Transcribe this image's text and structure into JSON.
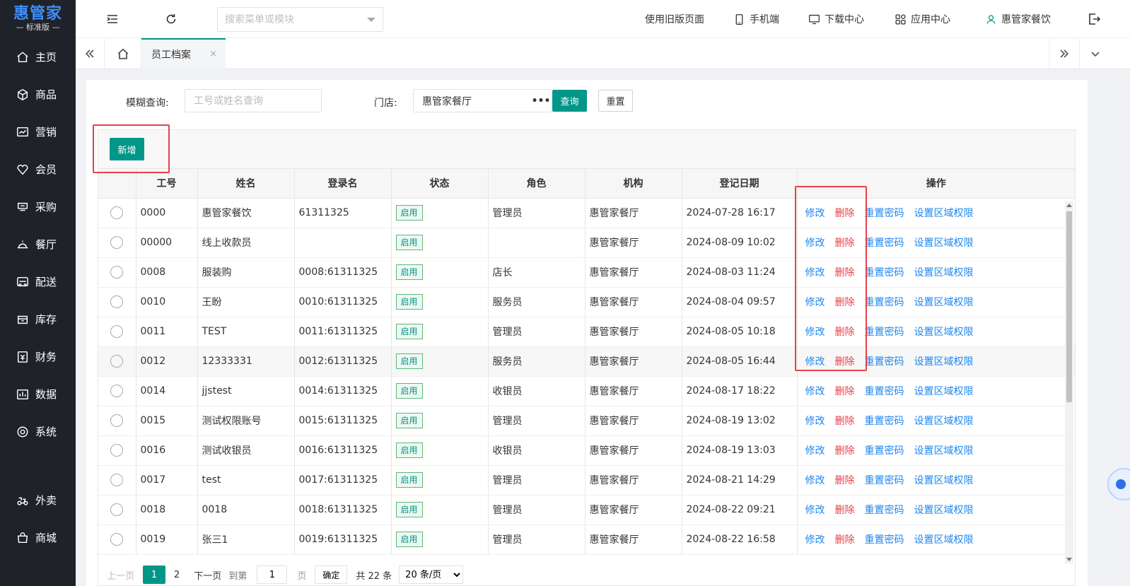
{
  "logo": {
    "main": "惠管家",
    "sub": "— 标准版 —"
  },
  "sidebar": {
    "items": [
      {
        "label": "主页",
        "icon": "home-icon"
      },
      {
        "label": "商品",
        "icon": "cube-icon"
      },
      {
        "label": "营销",
        "icon": "chart-icon"
      },
      {
        "label": "会员",
        "icon": "heart-icon"
      },
      {
        "label": "采购",
        "icon": "purchase-icon"
      },
      {
        "label": "餐厅",
        "icon": "dining-icon"
      },
      {
        "label": "配送",
        "icon": "delivery-icon"
      },
      {
        "label": "库存",
        "icon": "inventory-icon"
      },
      {
        "label": "财务",
        "icon": "finance-icon"
      },
      {
        "label": "数据",
        "icon": "data-icon"
      },
      {
        "label": "系统",
        "icon": "settings-icon"
      }
    ],
    "extra_items": [
      {
        "label": "外卖",
        "icon": "takeout-icon"
      },
      {
        "label": "商城",
        "icon": "mall-icon"
      }
    ]
  },
  "header": {
    "search_placeholder": "搜索菜单或模块",
    "old_version": "使用旧版页面",
    "mobile": "手机端",
    "download": "下载中心",
    "apps": "应用中心",
    "user": "惠管家餐饮"
  },
  "tabs": {
    "active": "员工档案",
    "close": "×"
  },
  "filters": {
    "fuzzy_label": "模糊查询:",
    "fuzzy_placeholder": "工号或姓名查询",
    "store_label": "门店:",
    "store_value": "惠管家餐厅",
    "more": "•••",
    "query_button": "查询",
    "reset_button": "重置"
  },
  "toolbar": {
    "add_button": "新增"
  },
  "table": {
    "columns": [
      "",
      "工号",
      "姓名",
      "登录名",
      "状态",
      "角色",
      "机构",
      "登记日期",
      "操作"
    ],
    "actions": {
      "edit": "修改",
      "delete": "删除",
      "reset_password": "重置密码",
      "region": "设置区域权限"
    },
    "rows": [
      {
        "id": "0000",
        "name": "惠管家餐饮",
        "login": "61311325",
        "status": "启用",
        "role": "管理员",
        "org": "惠管家餐厅",
        "date": "2024-07-28 16:17"
      },
      {
        "id": "00000",
        "name": "线上收款员",
        "login": "",
        "status": "启用",
        "role": "",
        "org": "惠管家餐厅",
        "date": "2024-08-09 10:02"
      },
      {
        "id": "0008",
        "name": "服装购",
        "login": "0008:61311325",
        "status": "启用",
        "role": "店长",
        "org": "惠管家餐厅",
        "date": "2024-08-03 11:24"
      },
      {
        "id": "0010",
        "name": "王盼",
        "login": "0010:61311325",
        "status": "启用",
        "role": "服务员",
        "org": "惠管家餐厅",
        "date": "2024-08-04 09:57"
      },
      {
        "id": "0011",
        "name": "TEST",
        "login": "0011:61311325",
        "status": "启用",
        "role": "管理员",
        "org": "惠管家餐厅",
        "date": "2024-08-05 10:18"
      },
      {
        "id": "0012",
        "name": "12333331",
        "login": "0012:61311325",
        "status": "启用",
        "role": "服务员",
        "org": "惠管家餐厅",
        "date": "2024-08-05 16:44"
      },
      {
        "id": "0014",
        "name": "jjstest",
        "login": "0014:61311325",
        "status": "启用",
        "role": "收银员",
        "org": "惠管家餐厅",
        "date": "2024-08-17 18:22"
      },
      {
        "id": "0015",
        "name": "测试权限账号",
        "login": "0015:61311325",
        "status": "启用",
        "role": "管理员",
        "org": "惠管家餐厅",
        "date": "2024-08-19 13:02"
      },
      {
        "id": "0016",
        "name": "测试收银员",
        "login": "0016:61311325",
        "status": "启用",
        "role": "收银员",
        "org": "惠管家餐厅",
        "date": "2024-08-19 13:03"
      },
      {
        "id": "0017",
        "name": "test",
        "login": "0017:61311325",
        "status": "启用",
        "role": "管理员",
        "org": "惠管家餐厅",
        "date": "2024-08-21 14:29"
      },
      {
        "id": "0018",
        "name": "0018",
        "login": "0018:61311325",
        "status": "启用",
        "role": "管理员",
        "org": "惠管家餐厅",
        "date": "2024-08-22 09:21"
      },
      {
        "id": "0019",
        "name": "张三1",
        "login": "0019:61311325",
        "status": "启用",
        "role": "管理员",
        "org": "惠管家餐厅",
        "date": "2024-08-22 16:58"
      }
    ]
  },
  "pagination": {
    "prev": "上一页",
    "current": "1",
    "next_page_num": "2",
    "next": "下一页",
    "goto": "到第",
    "goto_value": "1",
    "page_unit": "页",
    "confirm": "确定",
    "total": "共 22 条",
    "page_size": "20 条/页"
  },
  "colors": {
    "primary": "#009688",
    "link": "#1e87f0",
    "danger": "#e8404a",
    "sidebar": "#20222a"
  }
}
